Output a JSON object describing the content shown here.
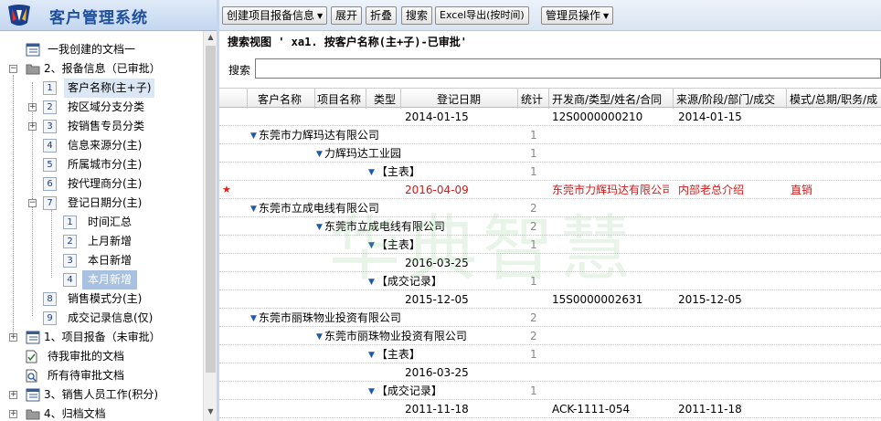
{
  "app": {
    "title": "客户管理系统"
  },
  "toolbar": {
    "create_label": "创建项目报备信息",
    "expand_label": "展开",
    "collapse_label": "折叠",
    "search_label": "搜索",
    "excel_label": "Excel导出(按时间)",
    "admin_label": "管理员操作"
  },
  "view": {
    "title": "搜索视图 ' xa1. 按客户名称(主+子)-已审批'",
    "search_label": "搜索",
    "search_value": ""
  },
  "sidebar": {
    "items": [
      {
        "label": "一我创建的文档一"
      },
      {
        "label": "2、报备信息（已审批）"
      },
      {
        "num": "1",
        "label": "客户名称(主+子)"
      },
      {
        "num": "2",
        "label": "按区域分支分类"
      },
      {
        "num": "3",
        "label": "按销售专员分类"
      },
      {
        "num": "4",
        "label": "信息来源分(主)"
      },
      {
        "num": "5",
        "label": "所属城市分(主)"
      },
      {
        "num": "6",
        "label": "按代理商分(主)"
      },
      {
        "num": "7",
        "label": "登记日期分(主)"
      },
      {
        "num": "1",
        "label": "时间汇总"
      },
      {
        "num": "2",
        "label": "上月新增"
      },
      {
        "num": "3",
        "label": "本日新增"
      },
      {
        "num": "4",
        "label": "本月新增"
      },
      {
        "num": "8",
        "label": "销售模式分(主)"
      },
      {
        "num": "9",
        "label": "成交记录信息(仅)"
      },
      {
        "label": "1、项目报备（未审批）"
      },
      {
        "label": "待我审批的文档"
      },
      {
        "label": "所有待审批文档"
      },
      {
        "label": "3、销售人员工作(积分)"
      },
      {
        "label": "4、归档文档"
      }
    ]
  },
  "grid": {
    "columns": [
      "客户名称",
      "项目名称",
      "类型",
      "登记日期",
      "统计",
      "开发商/类型/姓名/合同",
      "来源/阶段/部门/成交",
      "模式/总期/职务/成"
    ],
    "rows": [
      {
        "date": "2014-01-15",
        "dev": "12S0000000210",
        "src": "2014-01-15"
      },
      {
        "name": "东莞市力辉玛达有限公司",
        "count": "1"
      },
      {
        "name": "力辉玛达工业园",
        "count": "1"
      },
      {
        "name": "【主表】",
        "count": "1"
      },
      {
        "star": "★",
        "date": "2016-04-09",
        "dev": "东莞市力辉玛达有限公司",
        "src": "内部老总介绍",
        "mode": "直销"
      },
      {
        "name": "东莞市立成电线有限公司",
        "count": "2"
      },
      {
        "name": "东莞市立成电线有限公司",
        "count": "2"
      },
      {
        "name": "【主表】",
        "count": "1"
      },
      {
        "date": "2016-03-25"
      },
      {
        "name": "【成交记录】",
        "count": "1"
      },
      {
        "date": "2015-12-05",
        "dev": "15S0000002631",
        "src": "2015-12-05"
      },
      {
        "name": "东莞市丽珠物业投资有限公司",
        "count": "2"
      },
      {
        "name": "东莞市丽珠物业投资有限公司",
        "count": "2"
      },
      {
        "name": "【主表】",
        "count": "1"
      },
      {
        "date": "2016-03-25"
      },
      {
        "name": "【成交记录】",
        "count": "1"
      },
      {
        "date": "2011-11-18",
        "dev": "ACK-1111-054",
        "src": "2011-11-18"
      }
    ]
  },
  "watermark": "华典智慧",
  "colors": {
    "accent": "#1d4f9c",
    "highlight": "#d21a1a",
    "selected_bg": "#dce7f5"
  }
}
